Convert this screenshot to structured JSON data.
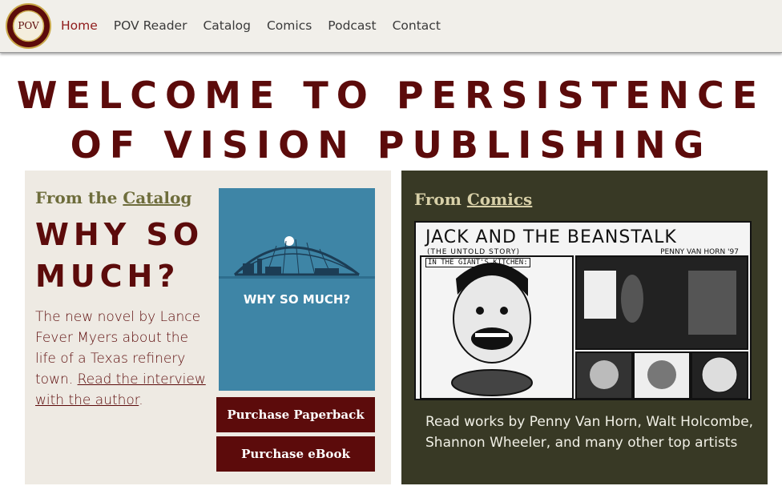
{
  "nav": {
    "items": [
      "Home",
      "POV Reader",
      "Catalog",
      "Comics",
      "Podcast",
      "Contact"
    ],
    "active": "Home"
  },
  "logo": {
    "text": "POV",
    "ring_text": "PERSISTENCE OF VISION PUBLISHING"
  },
  "page_title": "WELCOME TO PERSISTENCE OF VISION PUBLISHING",
  "catalog": {
    "kicker_prefix": "From the ",
    "kicker_link": "Catalog",
    "book_title": "WHY SO MUCH?",
    "description": "The new novel by Lance Fever Myers about the life of a Texas refinery town. ",
    "interview_link": "Read the interview with the author",
    "description_end": ".",
    "cover_text": "WHY SO MUCH?",
    "buttons": {
      "paperback": "Purchase Paperback",
      "ebook": "Purchase eBook"
    }
  },
  "comics": {
    "kicker_prefix": "From ",
    "kicker_link": "Comics",
    "comic_title": "JACK AND THE BEANSTALK",
    "comic_subtitle": "(THE UNTOLD STORY)",
    "comic_author": "PENNY VAN HORN '97",
    "comic_caption": "IN THE GIANT'S KITCHEN:",
    "description": "Read works by Penny Van Horn, Walt Holcombe, Shannon Wheeler, and many other top artists"
  },
  "colors": {
    "maroon": "#5c0b0b",
    "olive_text": "#6e6d3c",
    "dark_panel": "#383925",
    "light_panel": "#eeeae3",
    "cover_blue": "#3e85a6"
  }
}
